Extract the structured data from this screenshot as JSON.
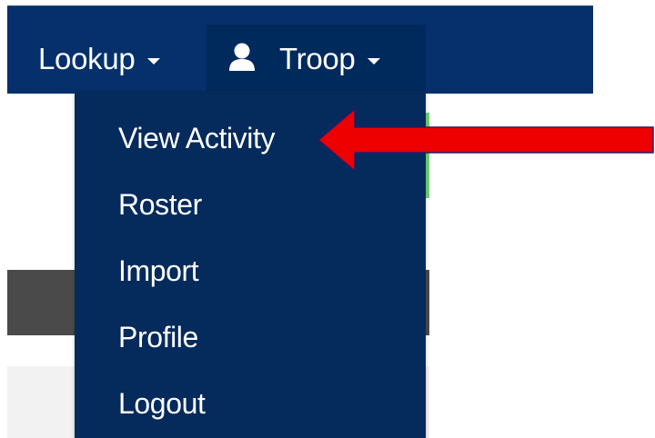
{
  "navbar": {
    "lookup_label": "Lookup",
    "troop_label": "Troop",
    "user_icon": "user-icon",
    "caret_icon": "caret-down-icon"
  },
  "dropdown": {
    "items": [
      {
        "label": "View Activity"
      },
      {
        "label": "Roster"
      },
      {
        "label": "Import"
      },
      {
        "label": "Profile"
      },
      {
        "label": "Logout"
      }
    ]
  },
  "annotation": {
    "arrow_icon": "red-arrow-icon",
    "color": "#ee0000"
  },
  "colors": {
    "navbar_bg": "#05306b",
    "active_tab_bg": "#002a5c",
    "dropdown_bg": "#052a5c",
    "text": "#ffffff"
  }
}
